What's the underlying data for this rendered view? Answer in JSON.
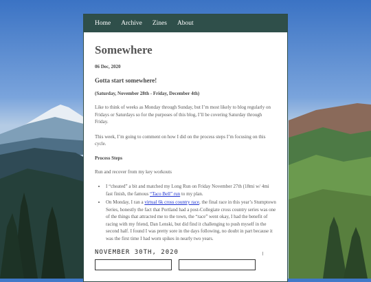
{
  "nav": {
    "items": [
      {
        "label": "Home"
      },
      {
        "label": "Archive"
      },
      {
        "label": "Zines"
      },
      {
        "label": "About"
      }
    ]
  },
  "post": {
    "title": "Somewhere",
    "date": "06 Dec, 2020",
    "heading": "Gotta start somewhere!",
    "range": "(Saturday, November 28th - Friday, December 4th)",
    "para1": "Like to think of weeks as Monday through Sunday, but I’m most likely to blog regularly on Fridays or Saturdays so for the purposes of this blog, I’ll be covering Saturday through Friday.",
    "para2": "This week, I’m going to comment on how I did on the process steps I’m focusing on this cycle.",
    "section": "Process Steps",
    "para3": "Run and recover from my key workouts",
    "bullet1": {
      "before": "I “cheated” a bit and matched my Long Run on Friday November 27th (18mi w/ 4mi fast finish, the famous ",
      "link": "“Taco Bell” run",
      "after": " to my plan."
    },
    "bullet2": {
      "before": "On Monday, I ran a ",
      "link": "virtual 6k cross country race",
      "after": ", the final race in this year’s Stumptown Series, honestly the fact that Portland had a post-Collegiate cross country series was one of the things that attracted me to the town, the “race” went okay, I had the benefit of racing with my friend, Dan Lenski, but did find it challenging to push myself in the second half. I found I was pretty sore in the days following, no doubt in part because it was the first time I had worn spikes in nearly two years."
    },
    "handwritten": "NOVEMBER 30TH, 2020"
  }
}
